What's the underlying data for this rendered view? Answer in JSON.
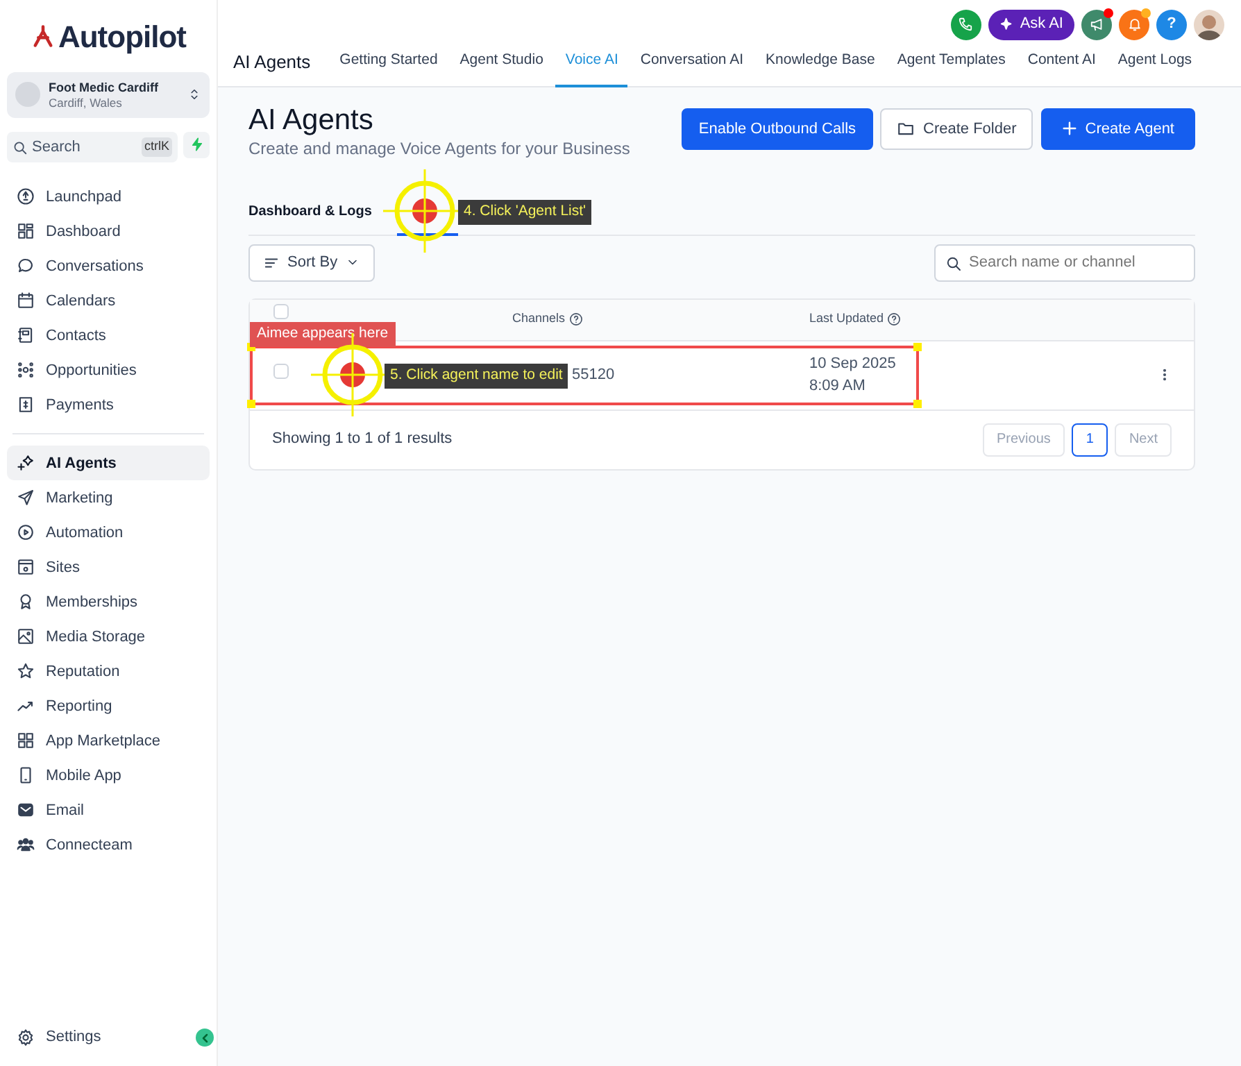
{
  "sidebar": {
    "logo": "Autopilot",
    "account": {
      "name": "Foot Medic Cardiff",
      "location": "Cardiff, Wales"
    },
    "search": {
      "placeholder": "Search",
      "shortcut": "ctrlK"
    },
    "sections": [
      [
        {
          "label": "Launchpad",
          "selected": false
        },
        {
          "label": "Dashboard",
          "selected": false
        },
        {
          "label": "Conversations",
          "selected": false
        },
        {
          "label": "Calendars",
          "selected": false
        },
        {
          "label": "Contacts",
          "selected": false
        },
        {
          "label": "Opportunities",
          "selected": false
        },
        {
          "label": "Payments",
          "selected": false
        }
      ],
      [
        {
          "label": "AI Agents",
          "selected": true
        },
        {
          "label": "Marketing",
          "selected": false
        },
        {
          "label": "Automation",
          "selected": false
        },
        {
          "label": "Sites",
          "selected": false
        },
        {
          "label": "Memberships",
          "selected": false
        },
        {
          "label": "Media Storage",
          "selected": false
        },
        {
          "label": "Reputation",
          "selected": false
        },
        {
          "label": "Reporting",
          "selected": false
        },
        {
          "label": "App Marketplace",
          "selected": false
        },
        {
          "label": "Mobile App",
          "selected": false
        },
        {
          "label": "Email",
          "selected": false
        },
        {
          "label": "Connecteam",
          "selected": false
        }
      ]
    ],
    "footer_item": {
      "label": "Settings"
    }
  },
  "topbar": {
    "ask_ai": "Ask AI",
    "help": "?",
    "notifications": [
      {
        "color": "#ff0000"
      },
      {
        "color": "#ffb020"
      }
    ]
  },
  "header": {
    "title": "AI Agents",
    "tabs": [
      {
        "label": "Getting Started",
        "selected": false
      },
      {
        "label": "Agent Studio",
        "selected": false
      },
      {
        "label": "Voice AI",
        "selected": true
      },
      {
        "label": "Conversation AI",
        "selected": false
      },
      {
        "label": "Knowledge Base",
        "selected": false
      },
      {
        "label": "Agent Templates",
        "selected": false
      },
      {
        "label": "Content AI",
        "selected": false
      },
      {
        "label": "Agent Logs",
        "selected": false
      }
    ]
  },
  "page": {
    "title": "AI Agents",
    "subtitle": "Create and manage Voice Agents for your Business",
    "buttons": [
      {
        "label": "Enable Outbound Calls",
        "kind": "primary"
      },
      {
        "label": "Create Folder",
        "kind": "folder"
      },
      {
        "label": "Create Agent",
        "kind": "create"
      }
    ],
    "subtabs": [
      {
        "label": "Dashboard & Logs",
        "selected": false
      },
      {
        "selected": true
      }
    ],
    "sort": "Sort By",
    "search": {
      "placeholder": "Search name or channel"
    },
    "table": {
      "all_checked": false,
      "columns": [
        "Channels",
        "Last Updated"
      ],
      "rows": [
        {
          "checked": false,
          "channel": "55120",
          "date": "10 Sep 2025",
          "time": "8:09 AM"
        }
      ]
    },
    "summary": "Showing 1 to 1 of 1 results",
    "pagination": [
      {
        "label": "Previous",
        "disabled": true,
        "selected": false
      },
      {
        "label": "1",
        "disabled": false,
        "selected": true
      },
      {
        "label": "Next",
        "disabled": true,
        "selected": false
      }
    ]
  },
  "annotations": [
    {
      "kind": "marker",
      "label": "4. Click 'Agent List'"
    },
    {
      "kind": "highlight",
      "label": "Aimee appears here"
    },
    {
      "kind": "marker",
      "label": "5. Click agent name to edit"
    }
  ]
}
